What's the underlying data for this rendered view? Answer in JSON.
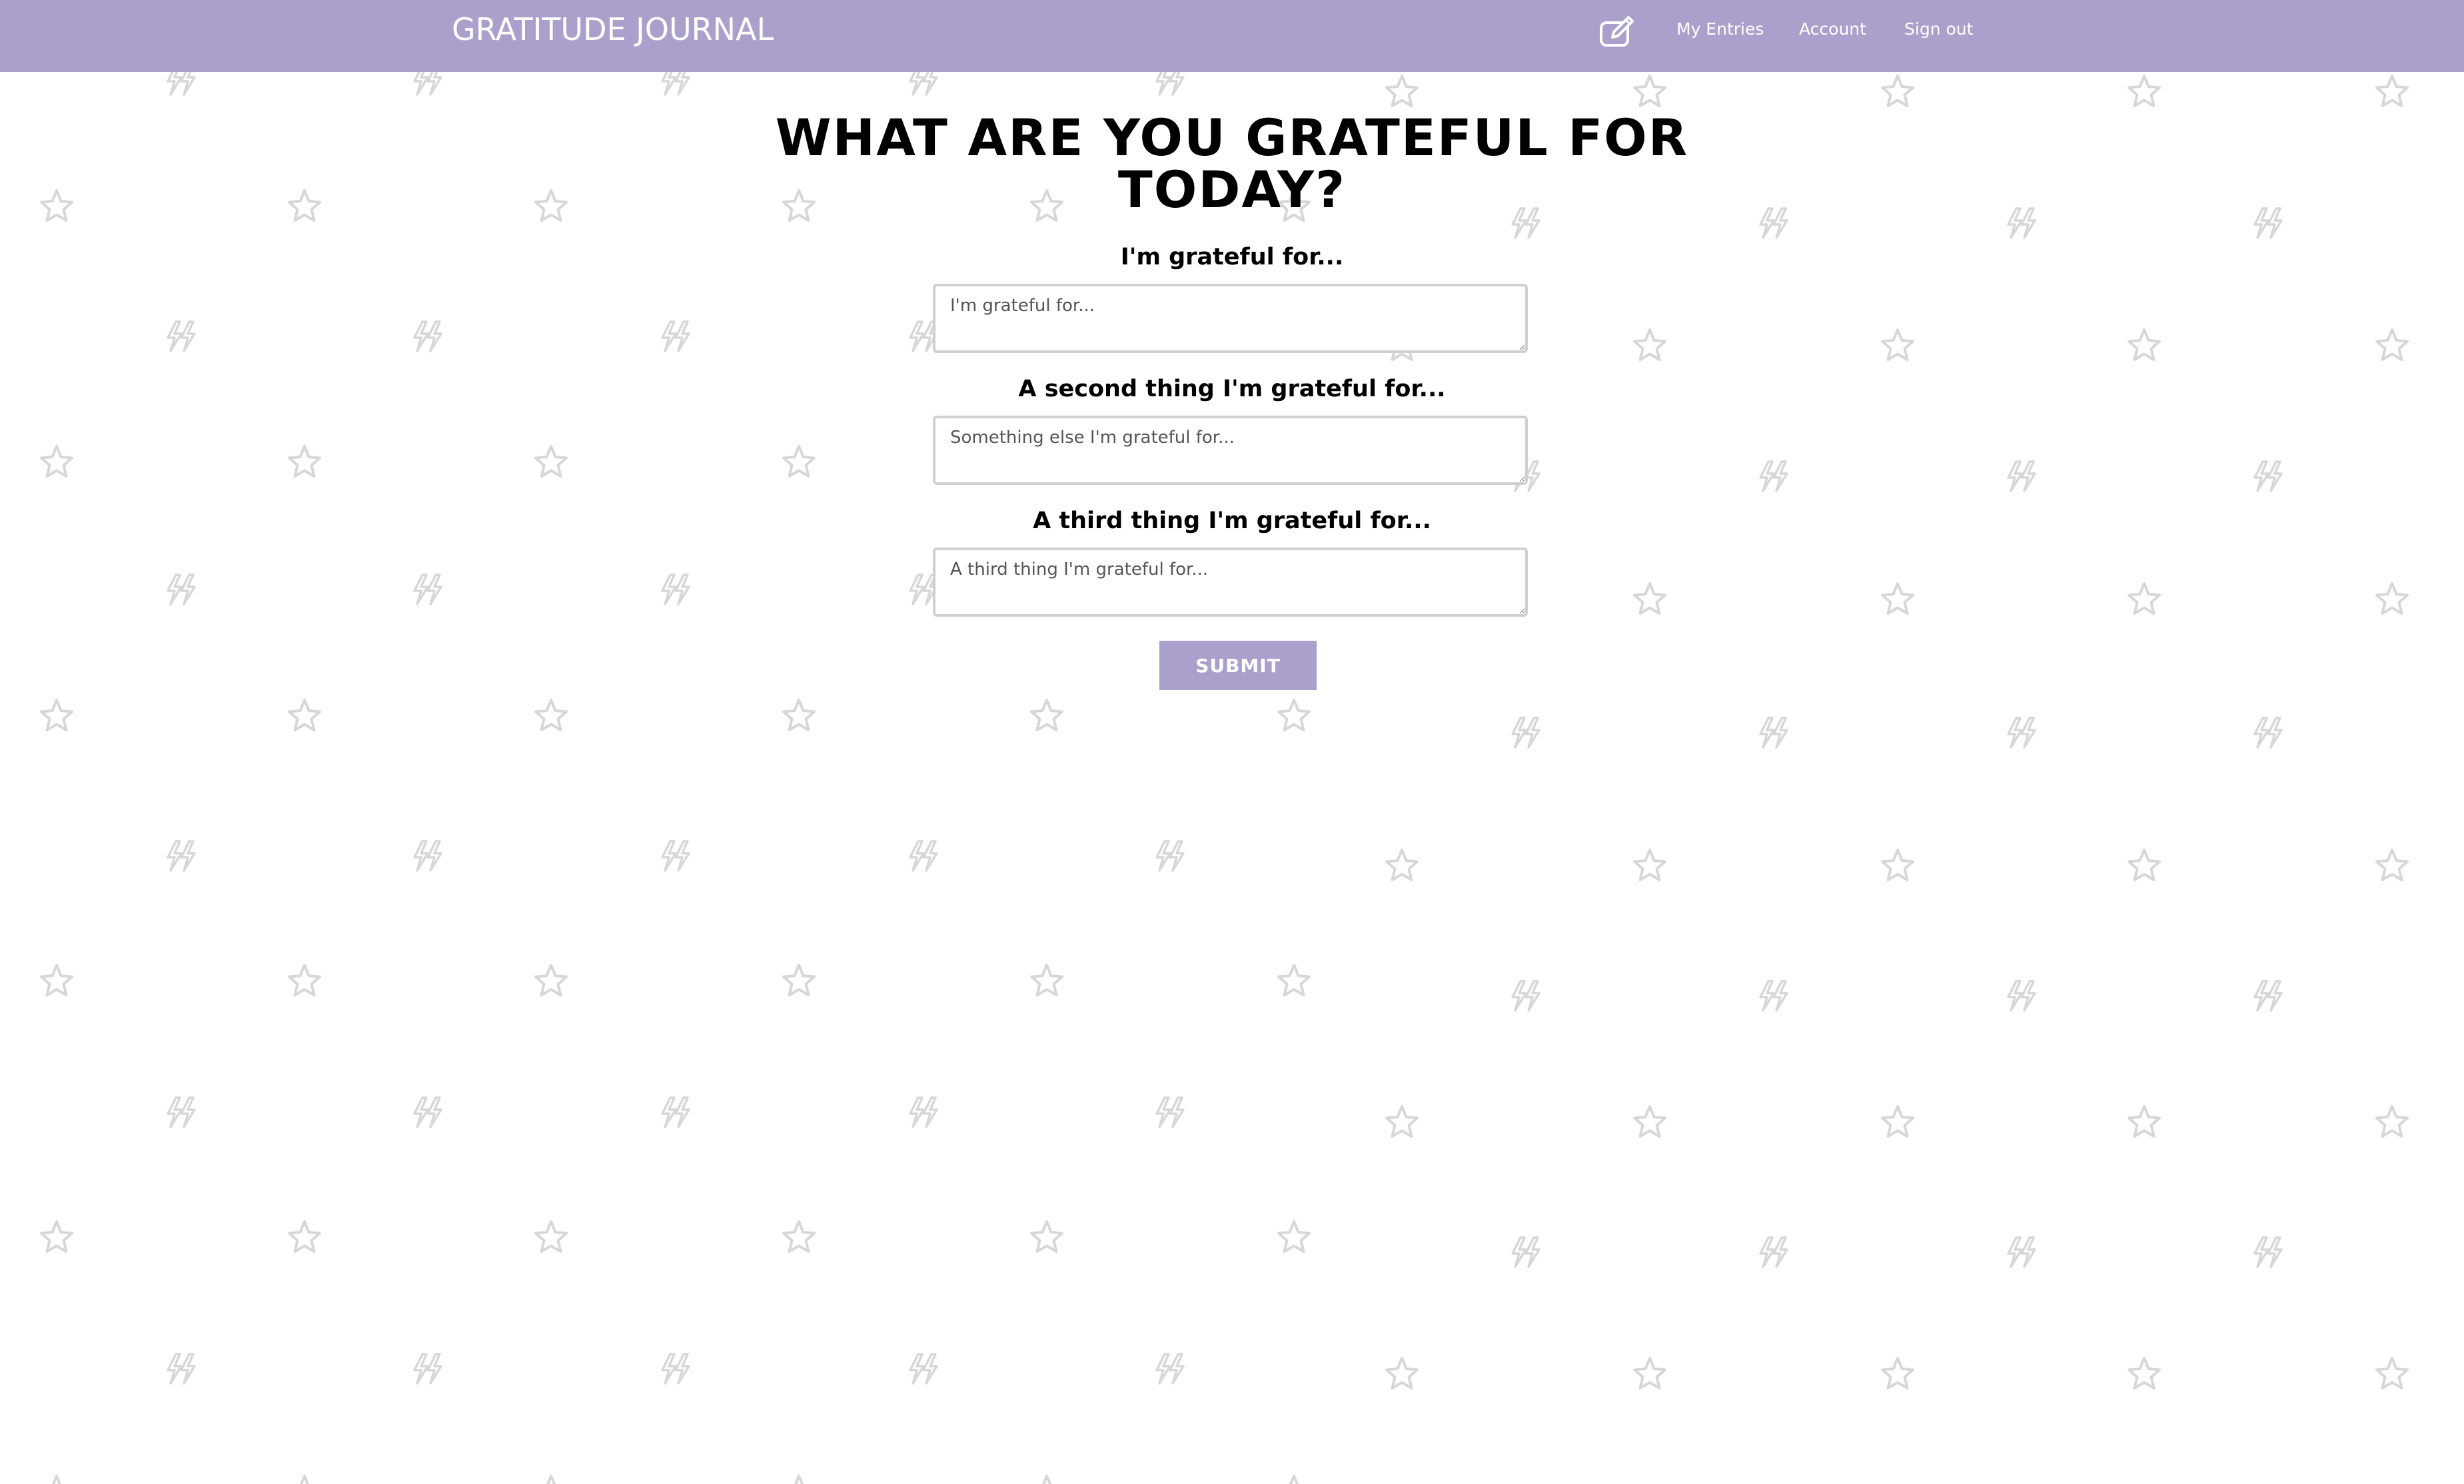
{
  "navbar": {
    "brand": "GRATITUDE JOURNAL",
    "links": [
      "My Entries",
      "Account",
      "Sign out"
    ],
    "icon": "edit-note-icon",
    "background_color": "#aba0cc"
  },
  "main": {
    "title": "WHAT ARE YOU GRATEFUL FOR TODAY?",
    "fields": [
      {
        "label": "I'm grateful for...",
        "placeholder": "I'm grateful for..."
      },
      {
        "label": "A second thing I'm grateful for...",
        "placeholder": "Something else I'm grateful for..."
      },
      {
        "label": "A third thing I'm grateful for...",
        "placeholder": "A third thing I'm grateful for..."
      }
    ],
    "submit_label": "SUBMIT"
  },
  "background": {
    "pattern_icons": [
      "star-icon",
      "lightning-icon"
    ],
    "pattern_color": "#d9d9d9"
  }
}
